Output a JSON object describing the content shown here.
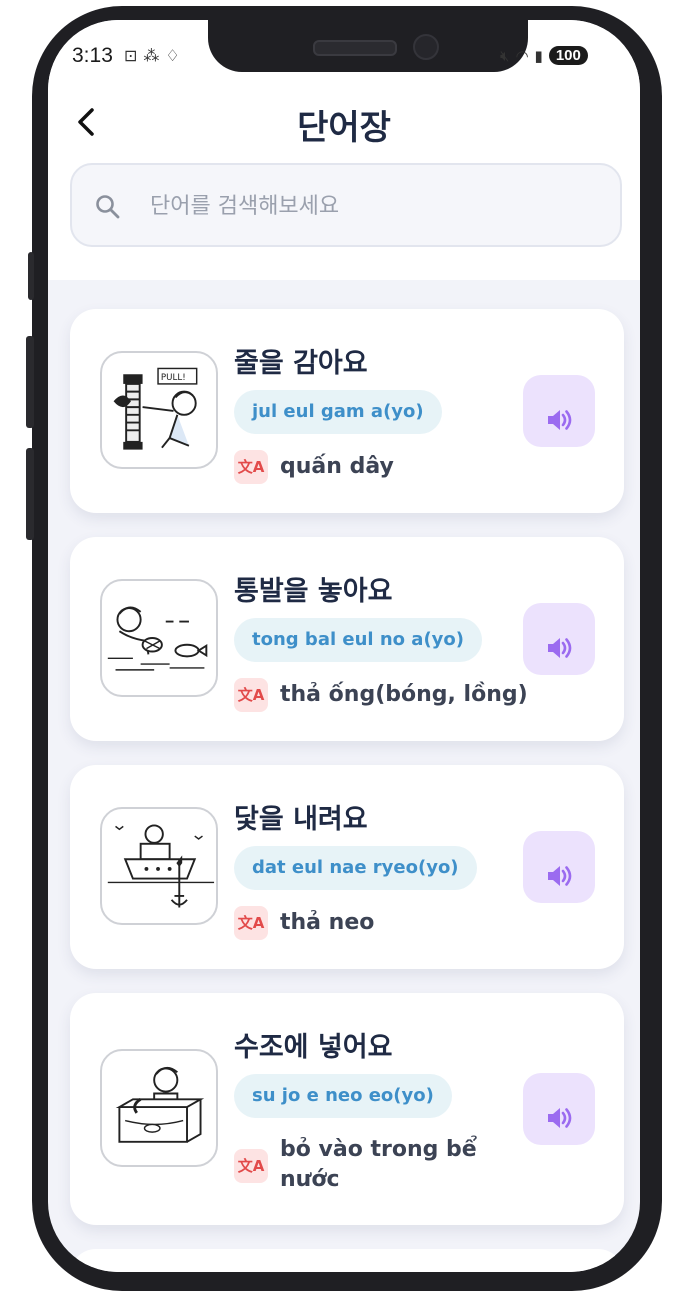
{
  "status": {
    "time": "3:13",
    "battery": "100",
    "left_icons": [
      "screenshot-icon",
      "app-icon",
      "cleaner-icon"
    ],
    "right_icons": [
      "mute-icon",
      "wifi-icon",
      "signal-icon"
    ]
  },
  "header": {
    "title": "단어장",
    "back_icon": "chevron-left-icon"
  },
  "search": {
    "placeholder": "단어를 검색해보세요",
    "value": ""
  },
  "words": [
    {
      "korean": "줄을 감아요",
      "romanization": "jul eul gam a(yo)",
      "meaning": "quấn dây",
      "image": "pull-rope-illustration"
    },
    {
      "korean": "통발을 놓아요",
      "romanization": "tong bal eul no a(yo)",
      "meaning": "thả ống(bóng, lồng)",
      "image": "fish-trap-illustration"
    },
    {
      "korean": "닻을 내려요",
      "romanization": "dat eul nae ryeo(yo)",
      "meaning": "thả neo",
      "image": "anchor-boat-illustration"
    },
    {
      "korean": "수조에 넣어요",
      "romanization": "su jo e neo eo(yo)",
      "meaning": "bỏ vào trong bể nước",
      "image": "fish-tank-illustration"
    }
  ],
  "colors": {
    "title": "#1f2a44",
    "romanization_text": "#3e8fc9",
    "romanization_bg": "#e7f3f7",
    "speaker_bg": "#ece2fd",
    "speaker_icon": "#9b6bf0",
    "translate_bg": "#fde3e3",
    "translate_icon": "#e24a4a"
  }
}
